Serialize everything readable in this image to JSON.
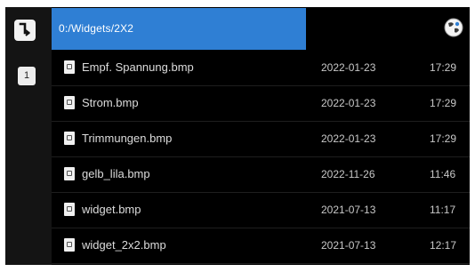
{
  "header": {
    "path": "0:/Widgets/2X2",
    "back_icon": "back-icon",
    "globe_icon": "globe-icon"
  },
  "sidebar": {
    "page_number": "1"
  },
  "files": [
    {
      "name": "Empf. Spannung.bmp",
      "date": "2022-01-23",
      "time": "17:29"
    },
    {
      "name": "Strom.bmp",
      "date": "2022-01-23",
      "time": "17:29"
    },
    {
      "name": "Trimmungen.bmp",
      "date": "2022-01-23",
      "time": "17:29"
    },
    {
      "name": "gelb_lila.bmp",
      "date": "2022-11-26",
      "time": "11:46"
    },
    {
      "name": "widget.bmp",
      "date": "2021-07-13",
      "time": "11:17"
    },
    {
      "name": "widget_2x2.bmp",
      "date": "2021-07-13",
      "time": "12:17"
    }
  ],
  "colors": {
    "accent": "#2f7fd4",
    "background": "#000000"
  }
}
